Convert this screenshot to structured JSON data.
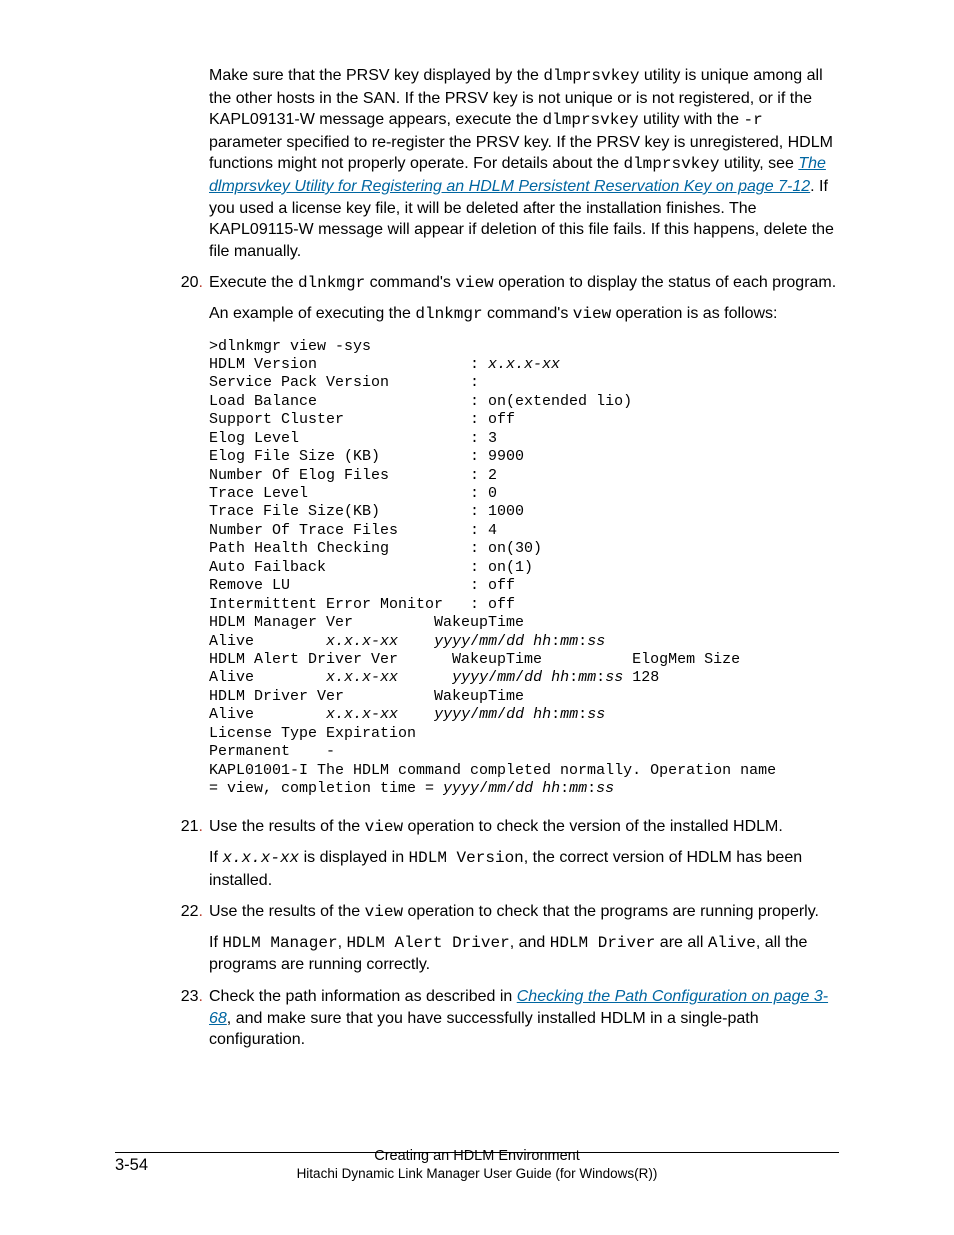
{
  "intro": {
    "t1": "Make sure that the PRSV key displayed by the ",
    "c1": "dlmprsvkey",
    "t2": " utility is unique among all the other hosts in the SAN. If the PRSV key is not unique or is not registered, or if the KAPL09131-W message appears, execute the ",
    "c2": "dlmprsvkey",
    "t3": " utility with the ",
    "c3": "-r",
    "t4": " parameter specified to re-register the PRSV key. If the PRSV key is unregistered, HDLM functions might not properly operate. For details about the ",
    "c4": "dlmprsvkey",
    "t5": " utility, see ",
    "link": "The dlmprsvkey Utility for Registering an HDLM Persistent Reservation Key on page 7-12",
    "t6": ". If you used a license key file, it will be deleted after the installation finishes. The KAPL09115-W message will appear if deletion of this file fails. If this happens, delete the file manually."
  },
  "step20": {
    "num": "20",
    "a1": "Execute the ",
    "ac1": "dlnkmgr",
    "a2": " command's ",
    "ac2": "view",
    "a3": " operation to display the status of each program.",
    "b1": "An example of executing the ",
    "bc1": "dlnkmgr",
    "b2": " command's ",
    "bc2": "view",
    "b3": " operation is as follows:"
  },
  "code": {
    "l1": ">dlnkmgr view -sys",
    "l2a": "HDLM Version                 : ",
    "l2b": "x.x.x-xx",
    "l3": "Service Pack Version         :",
    "l4": "Load Balance                 : on(extended lio)",
    "l5": "Support Cluster              : off",
    "l6": "Elog Level                   : 3",
    "l7": "Elog File Size (KB)          : 9900",
    "l8": "Number Of Elog Files         : 2",
    "l9": "Trace Level                  : 0",
    "l10": "Trace File Size(KB)          : 1000",
    "l11": "Number Of Trace Files        : 4",
    "l12": "Path Health Checking         : on(30)",
    "l13": "Auto Failback                : on(1)",
    "l14": "Remove LU                    : off",
    "l15": "Intermittent Error Monitor   : off",
    "l16": "HDLM Manager Ver         WakeupTime",
    "l17a": "Alive        ",
    "l17b": "x.x.x-xx",
    "l17c": "    ",
    "l17d": "yyyy",
    "l17e": "/",
    "l17f": "mm",
    "l17g": "/",
    "l17h": "dd hh",
    "l17i": ":",
    "l17j": "mm",
    "l17k": ":",
    "l17l": "ss",
    "l18": "HDLM Alert Driver Ver      WakeupTime          ElogMem Size",
    "l19a": "Alive        ",
    "l19b": "x.x.x-xx",
    "l19c": "      ",
    "l19d": "yyyy",
    "l19e": "/",
    "l19f": "mm",
    "l19g": "/",
    "l19h": "dd hh",
    "l19i": ":",
    "l19j": "mm",
    "l19k": ":",
    "l19l": "ss",
    "l19m": " 128",
    "l20": "HDLM Driver Ver          WakeupTime",
    "l21a": "Alive        ",
    "l21b": "x.x.x-xx",
    "l21c": "    ",
    "l21d": "yyyy",
    "l21e": "/",
    "l21f": "mm",
    "l21g": "/",
    "l21h": "dd hh",
    "l21i": ":",
    "l21j": "mm",
    "l21k": ":",
    "l21l": "ss",
    "l22": "License Type Expiration",
    "l23": "Permanent    -",
    "l24": "KAPL01001-I The HDLM command completed normally. Operation name ",
    "l25a": "= view, completion time = ",
    "l25b": "yyyy",
    "l25c": "/",
    "l25d": "mm",
    "l25e": "/",
    "l25f": "dd hh",
    "l25g": ":",
    "l25h": "mm",
    "l25i": ":",
    "l25j": "ss"
  },
  "step21": {
    "num": "21",
    "a1": "Use the results of the ",
    "ac1": "view",
    "a2": " operation to check the version of the installed HDLM.",
    "b1": "If ",
    "bc1": "x.x.x-xx",
    "b2": " is displayed in ",
    "bc2": "HDLM Version",
    "b3": ", the correct version of HDLM has been installed."
  },
  "step22": {
    "num": "22",
    "a1": "Use the results of the ",
    "ac1": "view",
    "a2": " operation to check that the programs are running properly.",
    "b1": "If ",
    "bc1": "HDLM Manager",
    "b2": ", ",
    "bc2": "HDLM Alert Driver",
    "b3": ", and ",
    "bc3": "HDLM Driver",
    "b4": " are all ",
    "bc4": "Alive",
    "b5": ", all the programs are running correctly."
  },
  "step23": {
    "num": "23",
    "a1": "Check the path information as described in ",
    "link": "Checking the Path Configuration on page 3-68",
    "a2": ", and make sure that you have successfully installed HDLM in a single-path configuration."
  },
  "footer": {
    "pagenum": "3-54",
    "title1": "Creating an HDLM Environment",
    "title2": "Hitachi Dynamic Link Manager User Guide (for Windows(R))"
  }
}
